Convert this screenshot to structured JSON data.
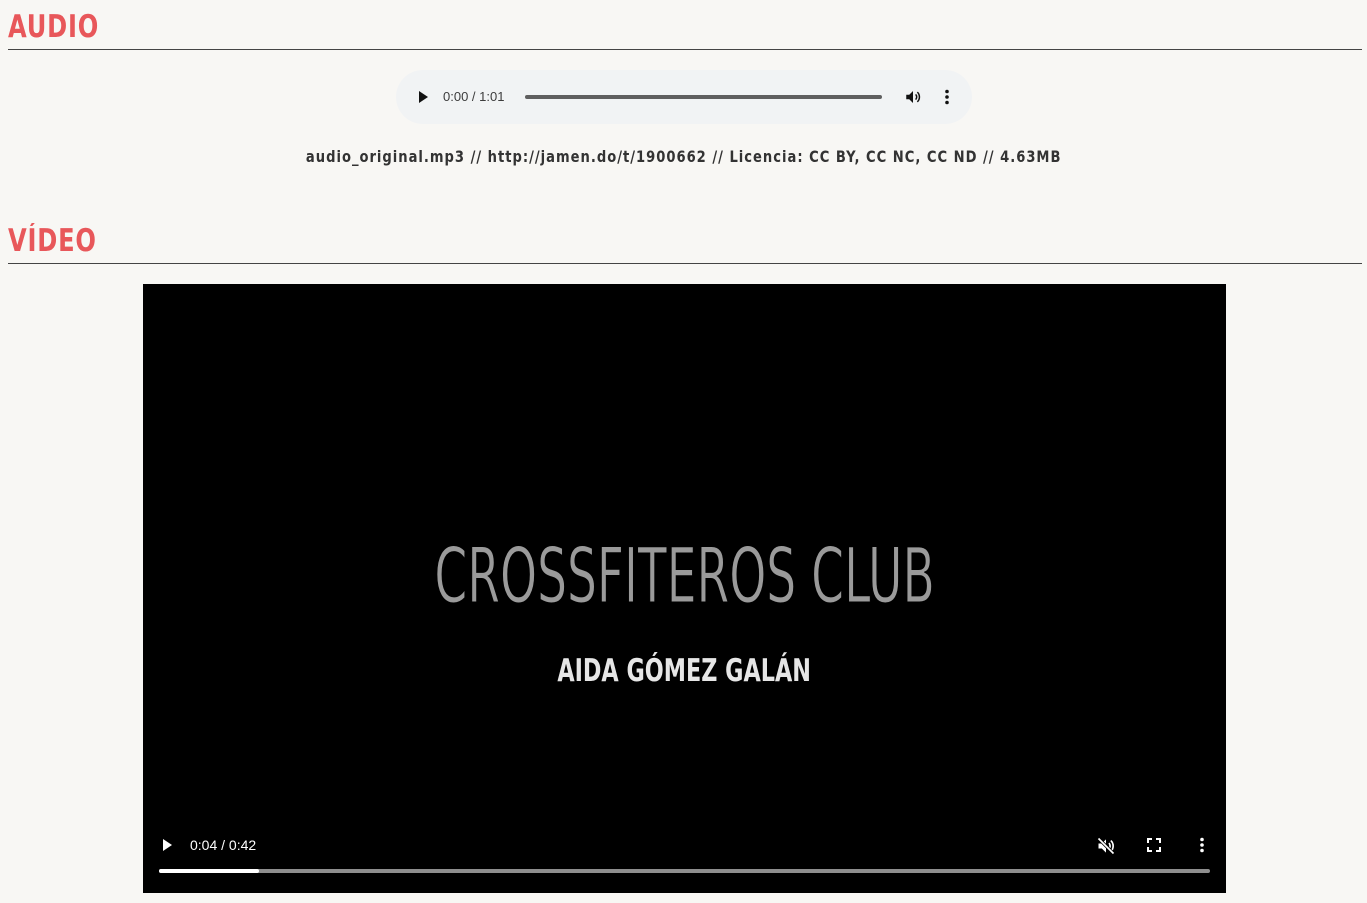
{
  "audio_section": {
    "heading": "AUDIO",
    "player": {
      "time": "0:00 / 1:01",
      "progress_fraction": 0
    },
    "caption": "audio_original.mp3 // http://jamen.do/t/1900662 // Licencia: CC BY, CC NC, CC ND // 4.63MB"
  },
  "video_section": {
    "heading": "VÍDEO",
    "frame": {
      "title": "CROSSFITEROS CLUB",
      "subtitle": "AIDA GÓMEZ GALÁN"
    },
    "player": {
      "time": "0:04 / 0:42",
      "progress_fraction": 0.0952,
      "muted": true
    }
  },
  "colors": {
    "heading": "#e8575a",
    "page_background": "#f8f7f4",
    "audio_player_background": "#f1f3f4",
    "video_background": "#000000"
  },
  "icons": {
    "audio_play": "play-icon",
    "audio_volume": "volume-icon",
    "audio_more": "more-vertical-icon",
    "video_play": "play-icon",
    "video_mute": "volume-muted-icon",
    "video_fullscreen": "fullscreen-icon",
    "video_more": "more-vertical-icon"
  }
}
